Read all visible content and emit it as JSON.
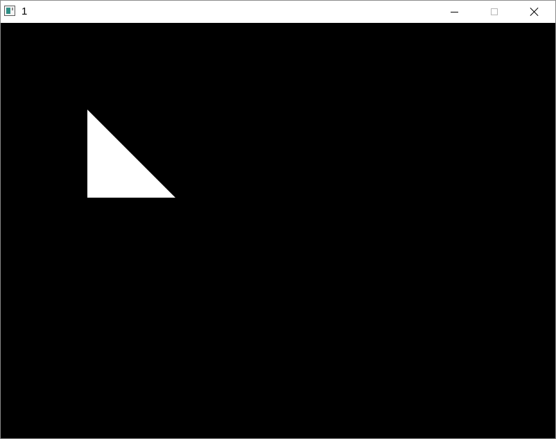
{
  "window": {
    "title": "1",
    "app_icon": "app-window-icon",
    "controls": {
      "minimize_icon": "minimize-icon",
      "maximize_icon": "maximize-icon",
      "close_icon": "close-icon"
    }
  },
  "canvas": {
    "background": "#000000",
    "shape": {
      "type": "triangle",
      "fill": "#ffffff"
    }
  }
}
